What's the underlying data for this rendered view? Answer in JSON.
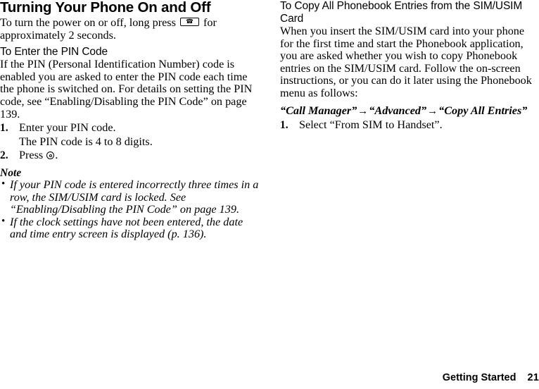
{
  "page": {
    "chapter_title": "Turning Your Phone On and Off",
    "footer_section": "Getting Started",
    "footer_page_number": "21"
  },
  "left_column": {
    "intro_paragraph_part1": "To turn the power on or off, long press ",
    "intro_paragraph_part2": " for approximately 2 seconds.",
    "power_key_icon_label": "power-key",
    "pin_section": {
      "heading": "To Enter the PIN Code",
      "paragraph": "If the PIN (Personal Identification Number) code is enabled you are asked to enter the PIN code each time the phone is switched on. For details on setting the PIN code, see “Enabling/Disabling the PIN Code” on page 139.",
      "steps": [
        {
          "num": "1.",
          "text": "Enter your PIN code."
        },
        {
          "num": "2.",
          "text_before_icon": "Press ",
          "text_after_icon": "."
        }
      ],
      "substep_text": "The PIN code is 4 to 8 digits.",
      "center_key_icon_label": "center-key"
    },
    "note": {
      "heading": "Note",
      "bullet_glyph": "•",
      "items": [
        "If your PIN code is entered incorrectly three times in a row, the SIM/USIM card is locked. See “Enabling/Disabling the PIN Code” on page 139.",
        "If the clock settings have not been entered, the date and time entry screen is displayed (p. 136)."
      ]
    }
  },
  "right_column": {
    "heading": "To Copy All Phonebook Entries from the SIM/USIM Card",
    "paragraph": "When you insert the SIM/USIM card into your phone for the first time and start the Phonebook application, you are asked whether you wish to copy Phonebook entries on the SIM/USIM card. Follow the on-screen instructions, or you can do it later using the Phonebook menu as follows:",
    "menu_path": {
      "item1": "“Call Manager”",
      "arrow1": "→",
      "item2": "“Advanced”",
      "arrow2": "→",
      "item3": "“Copy All Entries”"
    },
    "steps": [
      {
        "num": "1.",
        "text": "Select “From SIM to Handset”."
      }
    ]
  }
}
